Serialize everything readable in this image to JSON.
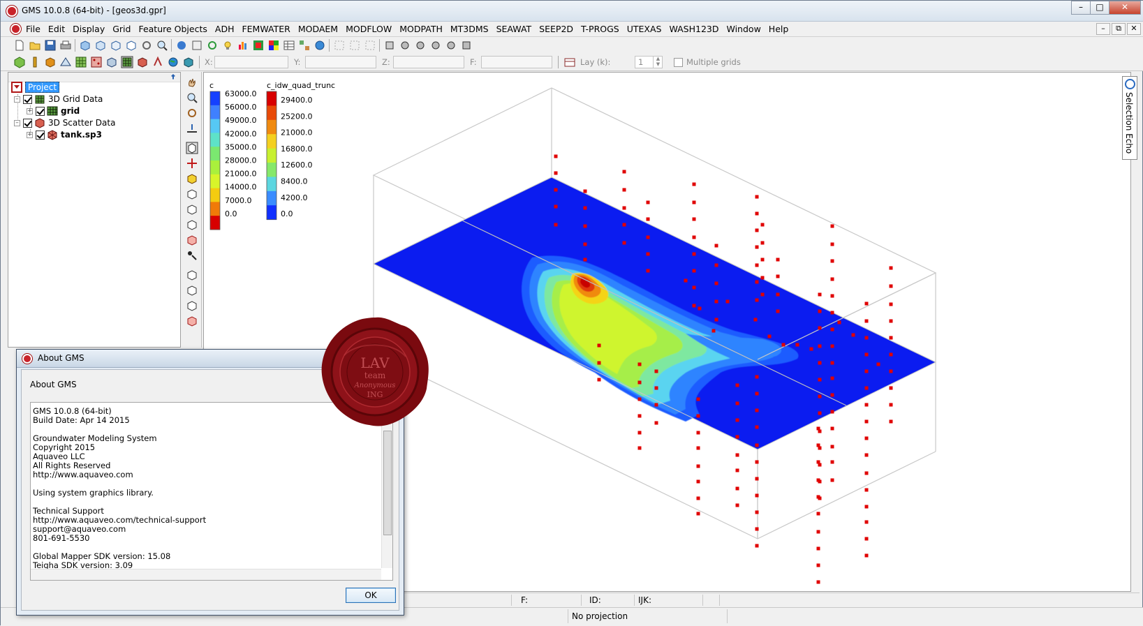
{
  "window": {
    "title": "GMS 10.0.8 (64-bit) - [geos3d.gpr]"
  },
  "menu": [
    "File",
    "Edit",
    "Display",
    "Grid",
    "Feature Objects",
    "ADH",
    "FEMWATER",
    "MODAEM",
    "MODFLOW",
    "MODPATH",
    "MT3DMS",
    "SEAWAT",
    "SEEP2D",
    "T-PROGS",
    "UTEXAS",
    "WASH123D",
    "Window",
    "Help"
  ],
  "coords": {
    "x_label": "X:",
    "y_label": "Y:",
    "z_label": "Z:",
    "f_label": "F:",
    "lay_label": "Lay (k):",
    "lay_value": "1",
    "multiple_grids": "Multiple grids"
  },
  "tree": {
    "project": "Project",
    "grid_folder": "3D Grid Data",
    "grid": "grid",
    "scatter_folder": "3D Scatter Data",
    "scatter": "tank.sp3"
  },
  "legend1": {
    "title": "c",
    "labels": [
      "63000.0",
      "56000.0",
      "49000.0",
      "42000.0",
      "35000.0",
      "28000.0",
      "21000.0",
      "14000.0",
      "7000.0",
      "0.0"
    ],
    "colors": [
      "#1540ff",
      "#3f80ff",
      "#56c8f5",
      "#5ee2c8",
      "#7be870",
      "#aaf03c",
      "#d8f52a",
      "#f4cc10",
      "#f07a08",
      "#d80000"
    ]
  },
  "legend2": {
    "title": "c_idw_quad_trunc",
    "labels": [
      "29400.0",
      "25200.0",
      "21000.0",
      "16800.0",
      "12600.0",
      "8400.0",
      "4200.0",
      "0.0"
    ],
    "colors": [
      "#d80000",
      "#e84a08",
      "#f08a10",
      "#f4d020",
      "#c8f030",
      "#86e86a",
      "#5cd6e0",
      "#3a8cff",
      "#1030ff"
    ]
  },
  "right_panel": {
    "label": "Selection Echo"
  },
  "status": {
    "f_label": "F:",
    "id_label": "ID:",
    "ijk_label": "IJK:",
    "projection": "No projection"
  },
  "about": {
    "title": "About GMS",
    "header": "About GMS",
    "lines": [
      "GMS 10.0.8 (64-bit)",
      "Build Date: Apr 14 2015",
      "",
      "Groundwater Modeling System",
      "Copyright 2015",
      "Aquaveo LLC",
      "All Rights Reserved",
      "http://www.aquaveo.com",
      "",
      "Using system graphics library.",
      "",
      "Technical Support",
      "http://www.aquaveo.com/technical-support",
      "support@aquaveo.com",
      "801-691-5530",
      "",
      "Global Mapper SDK version: 15.08",
      "Teigha SDK version: 3.09"
    ],
    "ok_label": "OK"
  },
  "seal": {
    "lines": [
      "LAV",
      "team",
      "Anonymous",
      "ING"
    ]
  }
}
